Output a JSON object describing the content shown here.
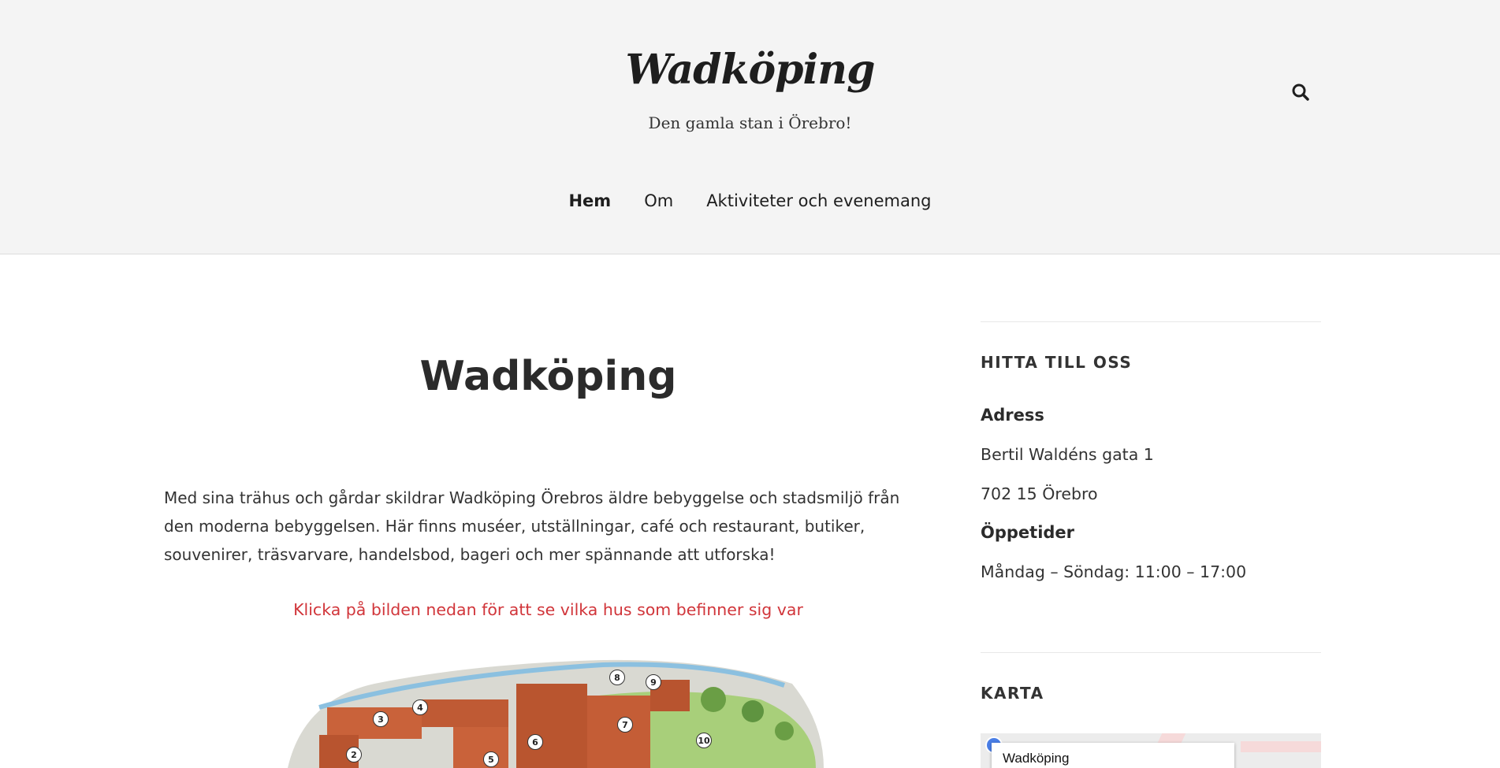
{
  "site": {
    "logo": "Wadköping",
    "tagline": "Den gamla stan i Örebro!",
    "search_icon": "search-icon"
  },
  "nav": {
    "items": [
      {
        "label": "Hem"
      },
      {
        "label": "Om"
      },
      {
        "label": "Aktiviteter och evenemang"
      }
    ]
  },
  "main": {
    "title": "Wadköping",
    "intro": "Med sina trähus och gårdar skildrar Wadköping Örebros äldre bebyggelse och stadsmiljö från den moderna bebyggelsen. Här finns muséer, utställningar, café och restaurant, butiker, souvenirer, träsvarvare, handelsbod, bageri och mer spännande att utforska!",
    "click_note": "Klicka på bilden nedan för att se vilka hus som befinner sig var",
    "map_markers": [
      "2",
      "3",
      "4",
      "5",
      "6",
      "7",
      "8",
      "9",
      "10"
    ]
  },
  "sidebar": {
    "find_us": {
      "title": "HITTA TILL OSS",
      "address_label": "Adress",
      "street": "Bertil Waldéns gata 1",
      "postal": "702 15 Örebro",
      "hours_label": "Öppetider",
      "hours": "Måndag – Söndag: 11:00 – 17:00"
    },
    "map": {
      "title": "KARTA",
      "place_name": "Wadköping"
    }
  },
  "colors": {
    "header_bg": "#f4f4f4",
    "accent_red": "#d1353a",
    "text_dark": "#2b2b2b"
  }
}
